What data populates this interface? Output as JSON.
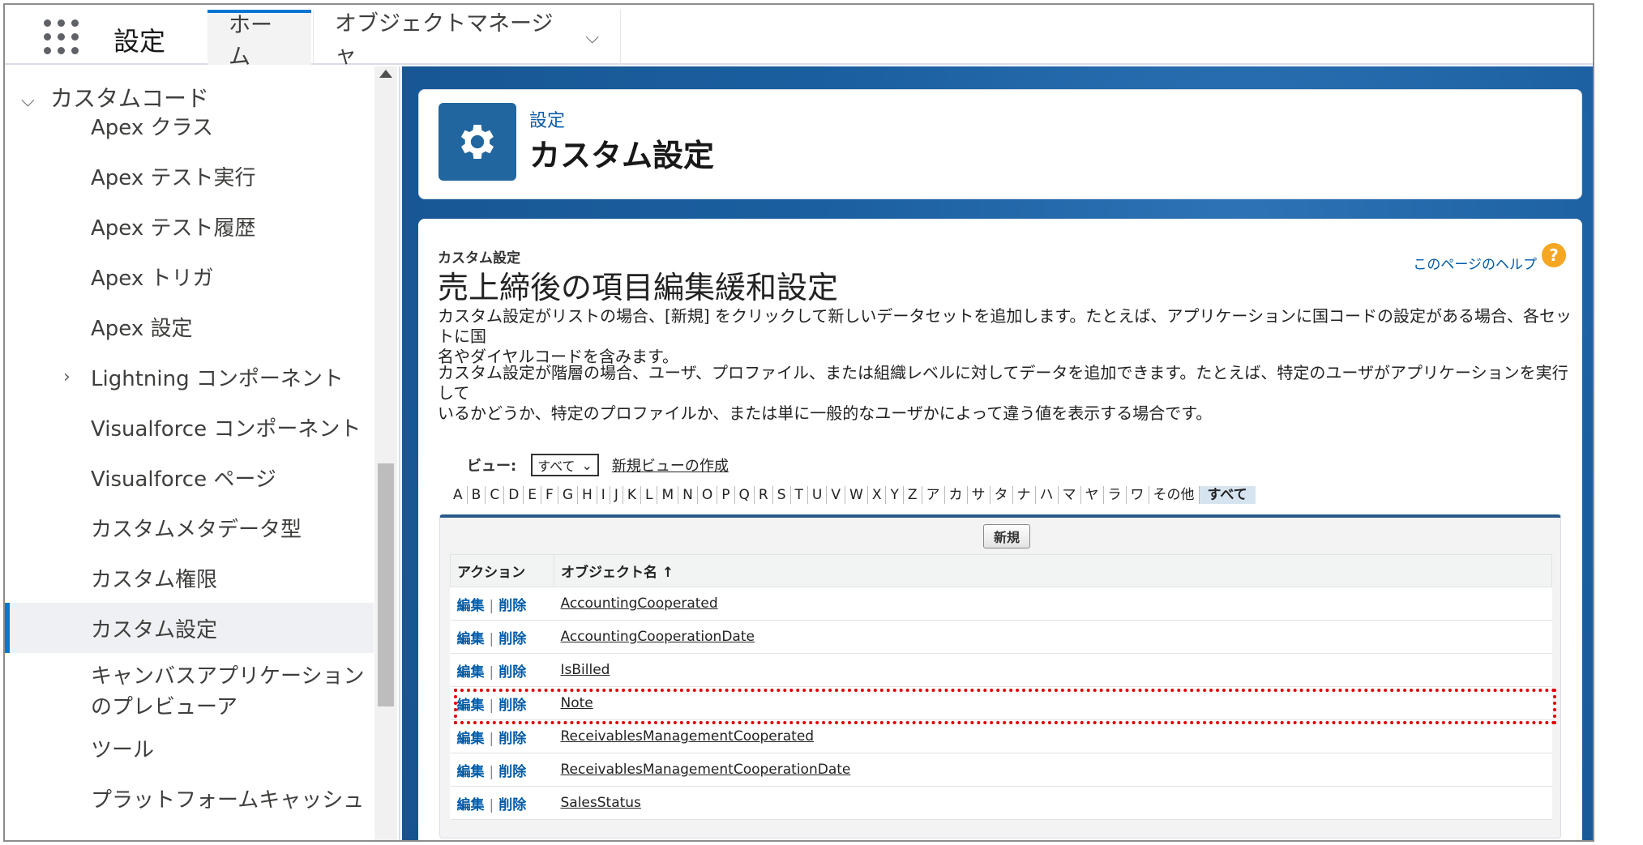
{
  "topbar": {
    "app_name": "設定",
    "tabs": [
      {
        "label": "ホーム",
        "active": true
      },
      {
        "label": "オブジェクトマネージャ",
        "dropdown": true
      }
    ]
  },
  "sidebar": {
    "section": "カスタムコード",
    "items": [
      {
        "label": "Apex クラス"
      },
      {
        "label": "Apex テスト実行"
      },
      {
        "label": "Apex テスト履歴"
      },
      {
        "label": "Apex トリガ"
      },
      {
        "label": "Apex 設定"
      },
      {
        "label": "Lightning コンポーネント",
        "expandable": true
      },
      {
        "label": "Visualforce コンポーネント"
      },
      {
        "label": "Visualforce ページ"
      },
      {
        "label": "カスタムメタデータ型"
      },
      {
        "label": "カスタム権限"
      },
      {
        "label": "カスタム設定",
        "selected": true
      },
      {
        "label": "キャンバスアプリケーション",
        "label2": "のプレビューア"
      },
      {
        "label": "ツール"
      },
      {
        "label": "プラットフォームキャッシュ"
      }
    ]
  },
  "header": {
    "breadcrumb": "設定",
    "title": "カスタム設定"
  },
  "content": {
    "small_label": "カスタム設定",
    "title": "売上締後の項目編集緩和設定",
    "help_link": "このページのヘルプ",
    "desc1_line1": "カスタム設定がリストの場合、[新規] をクリックして新しいデータセットを追加します。たとえば、アプリケーションに国コードの設定がある場合、各セットに国",
    "desc1_line2": "名やダイヤルコードを含みます。",
    "desc2_line1": "カスタム設定が階層の場合、ユーザ、プロファイル、または組織レベルに対してデータを追加できます。たとえば、特定のユーザがアプリケーションを実行して",
    "desc2_line2": "いるかどうか、特定のプロファイルか、または単に一般的なユーザかによって違う値を表示する場合です。",
    "view_label": "ビュー:",
    "view_selected": "すべて",
    "new_view_link": "新規ビューの作成",
    "alphabet": [
      "A",
      "B",
      "C",
      "D",
      "E",
      "F",
      "G",
      "H",
      "I",
      "J",
      "K",
      "L",
      "M",
      "N",
      "O",
      "P",
      "Q",
      "R",
      "S",
      "T",
      "U",
      "V",
      "W",
      "X",
      "Y",
      "Z",
      "ア",
      "カ",
      "サ",
      "タ",
      "ナ",
      "ハ",
      "マ",
      "ヤ",
      "ラ",
      "ワ",
      "その他",
      "すべて"
    ],
    "new_button": "新規",
    "columns": {
      "action": "アクション",
      "name": "オブジェクト名 ↑"
    },
    "edit_label": "編集",
    "delete_label": "削除",
    "rows": [
      {
        "name": "AccountingCooperated"
      },
      {
        "name": "AccountingCooperationDate"
      },
      {
        "name": "IsBilled"
      },
      {
        "name": "Note",
        "highlighted": true
      },
      {
        "name": "ReceivablesManagementCooperated"
      },
      {
        "name": "ReceivablesManagementCooperationDate"
      },
      {
        "name": "SalesStatus"
      }
    ]
  },
  "colors": {
    "brand": "#0176d3",
    "header_icon_bg": "#21669e",
    "highlight": "#e00000"
  }
}
